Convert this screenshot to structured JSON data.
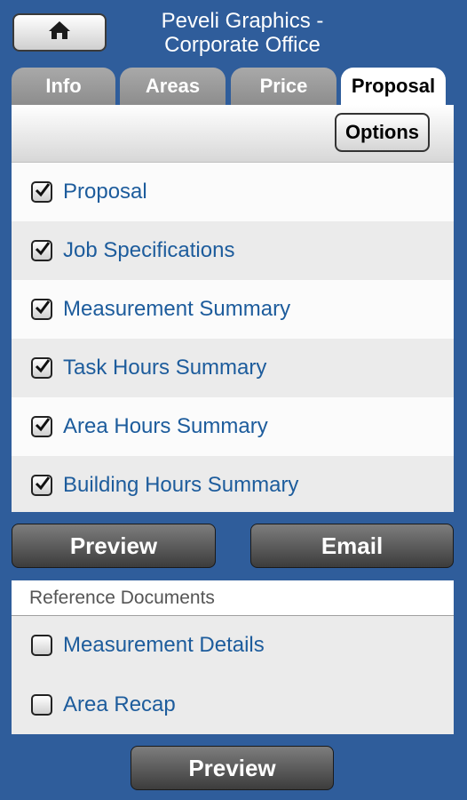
{
  "header": {
    "home_icon": "home-icon",
    "title_line1": "Peveli Graphics -",
    "title_line2": "Corporate Office"
  },
  "tabs": [
    {
      "label": "Info",
      "active": false
    },
    {
      "label": "Areas",
      "active": false
    },
    {
      "label": "Price",
      "active": false
    },
    {
      "label": "Proposal",
      "active": true
    }
  ],
  "options_label": "Options",
  "sections": [
    {
      "label": "Proposal",
      "checked": true
    },
    {
      "label": "Job Specifications",
      "checked": true
    },
    {
      "label": "Measurement Summary",
      "checked": true
    },
    {
      "label": "Task Hours Summary",
      "checked": true
    },
    {
      "label": "Area Hours Summary",
      "checked": true
    },
    {
      "label": "Building Hours Summary",
      "checked": true
    }
  ],
  "actions": {
    "preview": "Preview",
    "email": "Email"
  },
  "reference": {
    "header": "Reference Documents",
    "items": [
      {
        "label": "Measurement Details",
        "checked": false
      },
      {
        "label": "Area Recap",
        "checked": false
      }
    ],
    "preview": "Preview"
  },
  "colors": {
    "background": "#2f5d9b",
    "link_text": "#1d5c9c",
    "tab_inactive": "#9b9b9b"
  }
}
